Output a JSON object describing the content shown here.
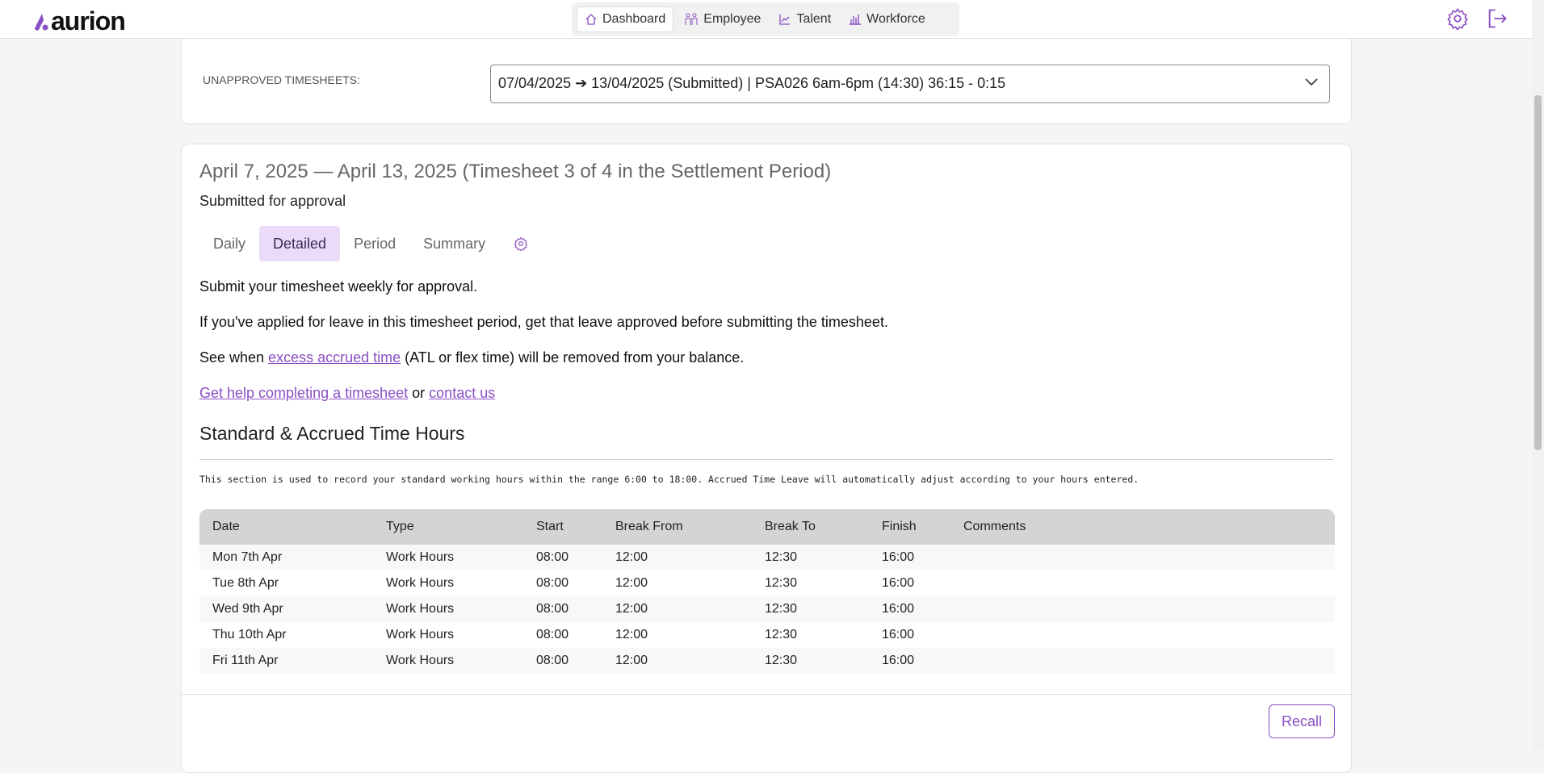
{
  "app": {
    "logo_text": "aurion",
    "accent": "#8a4fc4"
  },
  "nav": {
    "items": [
      {
        "label": "Dashboard",
        "icon": "home-icon"
      },
      {
        "label": "Employee",
        "icon": "people-icon"
      },
      {
        "label": "Talent",
        "icon": "chart-line-icon"
      },
      {
        "label": "Workforce",
        "icon": "bar-chart-icon"
      }
    ],
    "active": "Dashboard"
  },
  "header_icons": [
    "gear-icon",
    "logout-icon"
  ],
  "unapproved": {
    "label": "UNAPPROVED TIMESHEETS:",
    "selected": "07/04/2025 ➔ 13/04/2025 (Submitted) | PSA026 6am-6pm (14:30) 36:15 - 0:15"
  },
  "timesheet": {
    "title": "April 7, 2025 — April 13, 2025 (Timesheet 3 of 4 in the Settlement Period)",
    "status": "Submitted for approval",
    "tabs": [
      "Daily",
      "Detailed",
      "Period",
      "Summary"
    ],
    "active_tab": "Detailed",
    "p1": "Submit your timesheet weekly for approval.",
    "p2": "If you've applied for leave in this timesheet period, get that leave approved before submitting the timesheet.",
    "p3_pre": "See when ",
    "p3_link": "excess accrued time",
    "p3_post": " (ATL or flex time) will be removed from your balance.",
    "p4_link1": "Get help completing a timesheet",
    "p4_mid": " or ",
    "p4_link2": "contact us",
    "section_title": "Standard & Accrued Time Hours",
    "section_note": "This section is used to record your standard working hours within the range 6:00 to 18:00.  Accrued Time Leave will automatically adjust according to your hours entered.",
    "columns": [
      "Date",
      "Type",
      "Start",
      "Break From",
      "Break To",
      "Finish",
      "Comments"
    ],
    "rows": [
      [
        "Mon 7th Apr",
        "Work Hours",
        "08:00",
        "12:00",
        "12:30",
        "16:00",
        ""
      ],
      [
        "Tue 8th Apr",
        "Work Hours",
        "08:00",
        "12:00",
        "12:30",
        "16:00",
        ""
      ],
      [
        "Wed 9th Apr",
        "Work Hours",
        "08:00",
        "12:00",
        "12:30",
        "16:00",
        ""
      ],
      [
        "Thu 10th Apr",
        "Work Hours",
        "08:00",
        "12:00",
        "12:30",
        "16:00",
        ""
      ],
      [
        "Fri 11th Apr",
        "Work Hours",
        "08:00",
        "12:00",
        "12:30",
        "16:00",
        ""
      ]
    ],
    "recall_label": "Recall"
  }
}
